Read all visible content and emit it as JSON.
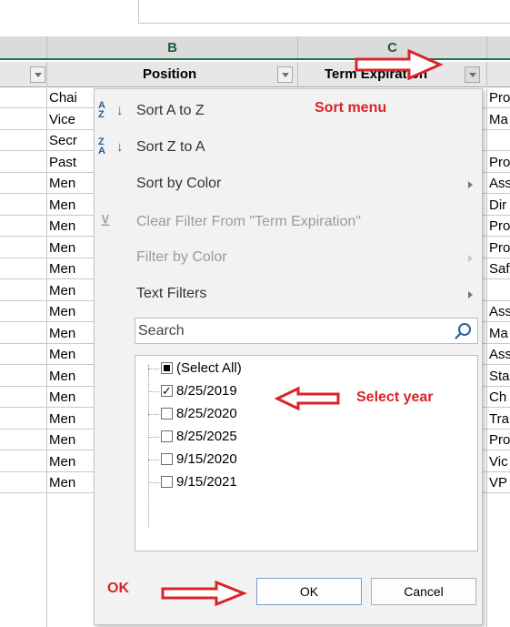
{
  "columns": {
    "b_letter": "B",
    "c_letter": "C"
  },
  "table_header": {
    "position": "Position",
    "term_expiration": "Term Expiration"
  },
  "column_a_cells": [
    "Chai",
    "Vice",
    "Secr",
    "Past",
    "Men",
    "Men",
    "Men",
    "Men",
    "Men",
    "Men",
    "Men",
    "Men",
    "Men",
    "Men",
    "Men",
    "Men",
    "Men",
    "Men",
    "Men"
  ],
  "column_d_cells": [
    "Pro",
    "Ma",
    "",
    "Pro",
    "Ass",
    "Dir",
    "Pro",
    "Pro",
    "Saf",
    "",
    "Ass",
    "Ma",
    "Ass",
    "Sta",
    "Ch",
    "Tra",
    "Pro",
    "Vic",
    "VP"
  ],
  "menu": {
    "sort_az": "Sort A to Z",
    "sort_za": "Sort Z to A",
    "sort_by_color": "Sort by Color",
    "clear_filter": "Clear Filter From \"Term Expiration\"",
    "filter_by_color": "Filter by Color",
    "text_filters": "Text Filters",
    "search_placeholder": "Search",
    "items": [
      {
        "label": "(Select All)",
        "state": "partial"
      },
      {
        "label": "8/25/2019",
        "state": "checked"
      },
      {
        "label": "8/25/2020",
        "state": "unchecked"
      },
      {
        "label": "8/25/2025",
        "state": "unchecked"
      },
      {
        "label": "9/15/2020",
        "state": "unchecked"
      },
      {
        "label": "9/15/2021",
        "state": "unchecked"
      }
    ],
    "ok": "OK",
    "cancel": "Cancel"
  },
  "annotations": {
    "sort_menu": "Sort menu",
    "select_year": "Select year",
    "ok": "OK",
    "color": "#d9242b"
  }
}
